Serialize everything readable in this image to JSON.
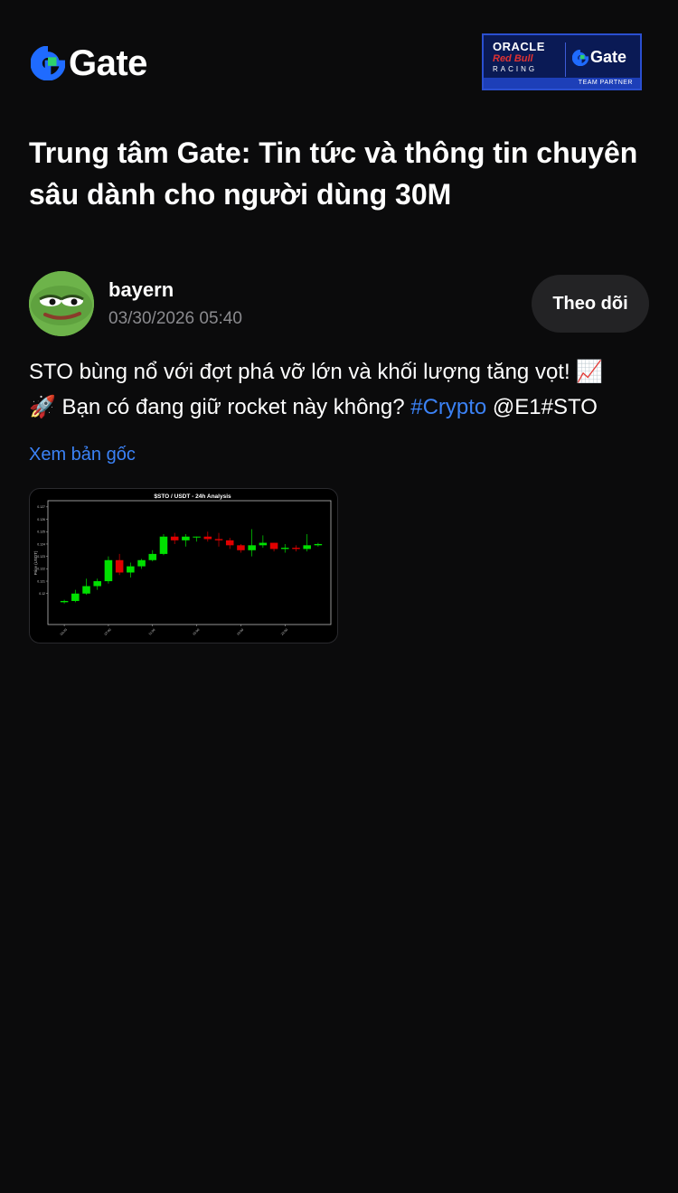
{
  "header": {
    "brand": "Gate",
    "partner": {
      "oracle": "ORACLE",
      "redbull": "Red Bull",
      "racing": "RACING",
      "gate": "Gate",
      "badge": "TEAM PARTNER"
    }
  },
  "page_title": "Trung tâm Gate: Tin tức và thông tin chuyên sâu dành cho người dùng 30M",
  "post": {
    "author": "bayern",
    "timestamp": "03/30/2026 05:40",
    "follow_label": "Theo dõi",
    "text_part1": "STO bùng nổ với đợt phá vỡ lớn và khối lượng tăng vọt! ",
    "emoji_chart": "📈",
    "emoji_rocket": "🚀",
    "text_part2": " Bạn có đang giữ rocket này không? ",
    "hashtag": "#Crypto",
    "text_part3": " @E1#STO",
    "view_original": "Xem bản gốc"
  },
  "colors": {
    "background": "#0b0b0c",
    "link": "#3b82f6",
    "up": "#00e000",
    "down": "#e00000"
  },
  "chart_data": {
    "type": "candlestick",
    "title": "$STO / USDT - 24h Analysis",
    "ylabel": "Price (USDT)",
    "ylim": [
      0.1175,
      0.1275
    ],
    "yticks": [
      "0.12",
      "0.121",
      "0.122",
      "0.123",
      "0.124",
      "0.125",
      "0.126",
      "0.127"
    ],
    "xticks": [
      "03-29",
      "07:00",
      "11:00",
      "15:00",
      "19:00",
      "23:00"
    ],
    "candles": [
      {
        "o": 0.1193,
        "h": 0.1195,
        "l": 0.1192,
        "c": 0.1194
      },
      {
        "o": 0.1194,
        "h": 0.1203,
        "l": 0.1193,
        "c": 0.12
      },
      {
        "o": 0.12,
        "h": 0.1212,
        "l": 0.1199,
        "c": 0.1206
      },
      {
        "o": 0.1206,
        "h": 0.1212,
        "l": 0.1203,
        "c": 0.121
      },
      {
        "o": 0.121,
        "h": 0.123,
        "l": 0.1208,
        "c": 0.1227
      },
      {
        "o": 0.1227,
        "h": 0.1232,
        "l": 0.1215,
        "c": 0.1217
      },
      {
        "o": 0.1217,
        "h": 0.1225,
        "l": 0.1213,
        "c": 0.1222
      },
      {
        "o": 0.1222,
        "h": 0.1228,
        "l": 0.122,
        "c": 0.1227
      },
      {
        "o": 0.1227,
        "h": 0.1235,
        "l": 0.1226,
        "c": 0.1232
      },
      {
        "o": 0.1232,
        "h": 0.1248,
        "l": 0.1231,
        "c": 0.1246
      },
      {
        "o": 0.1246,
        "h": 0.1249,
        "l": 0.124,
        "c": 0.1243
      },
      {
        "o": 0.1243,
        "h": 0.1248,
        "l": 0.1238,
        "c": 0.1246
      },
      {
        "o": 0.1246,
        "h": 0.1246,
        "l": 0.1242,
        "c": 0.1246
      },
      {
        "o": 0.1246,
        "h": 0.125,
        "l": 0.1242,
        "c": 0.1244
      },
      {
        "o": 0.1244,
        "h": 0.1249,
        "l": 0.1238,
        "c": 0.1243
      },
      {
        "o": 0.1243,
        "h": 0.1245,
        "l": 0.1236,
        "c": 0.1239
      },
      {
        "o": 0.1239,
        "h": 0.124,
        "l": 0.1233,
        "c": 0.1235
      },
      {
        "o": 0.1235,
        "h": 0.1252,
        "l": 0.123,
        "c": 0.1239
      },
      {
        "o": 0.1239,
        "h": 0.1247,
        "l": 0.1237,
        "c": 0.1241
      },
      {
        "o": 0.1241,
        "h": 0.1241,
        "l": 0.1234,
        "c": 0.1236
      },
      {
        "o": 0.1236,
        "h": 0.124,
        "l": 0.1233,
        "c": 0.1237
      },
      {
        "o": 0.1237,
        "h": 0.1239,
        "l": 0.1234,
        "c": 0.1236
      },
      {
        "o": 0.1236,
        "h": 0.1248,
        "l": 0.1234,
        "c": 0.1239
      },
      {
        "o": 0.1239,
        "h": 0.1241,
        "l": 0.1238,
        "c": 0.124
      }
    ]
  }
}
